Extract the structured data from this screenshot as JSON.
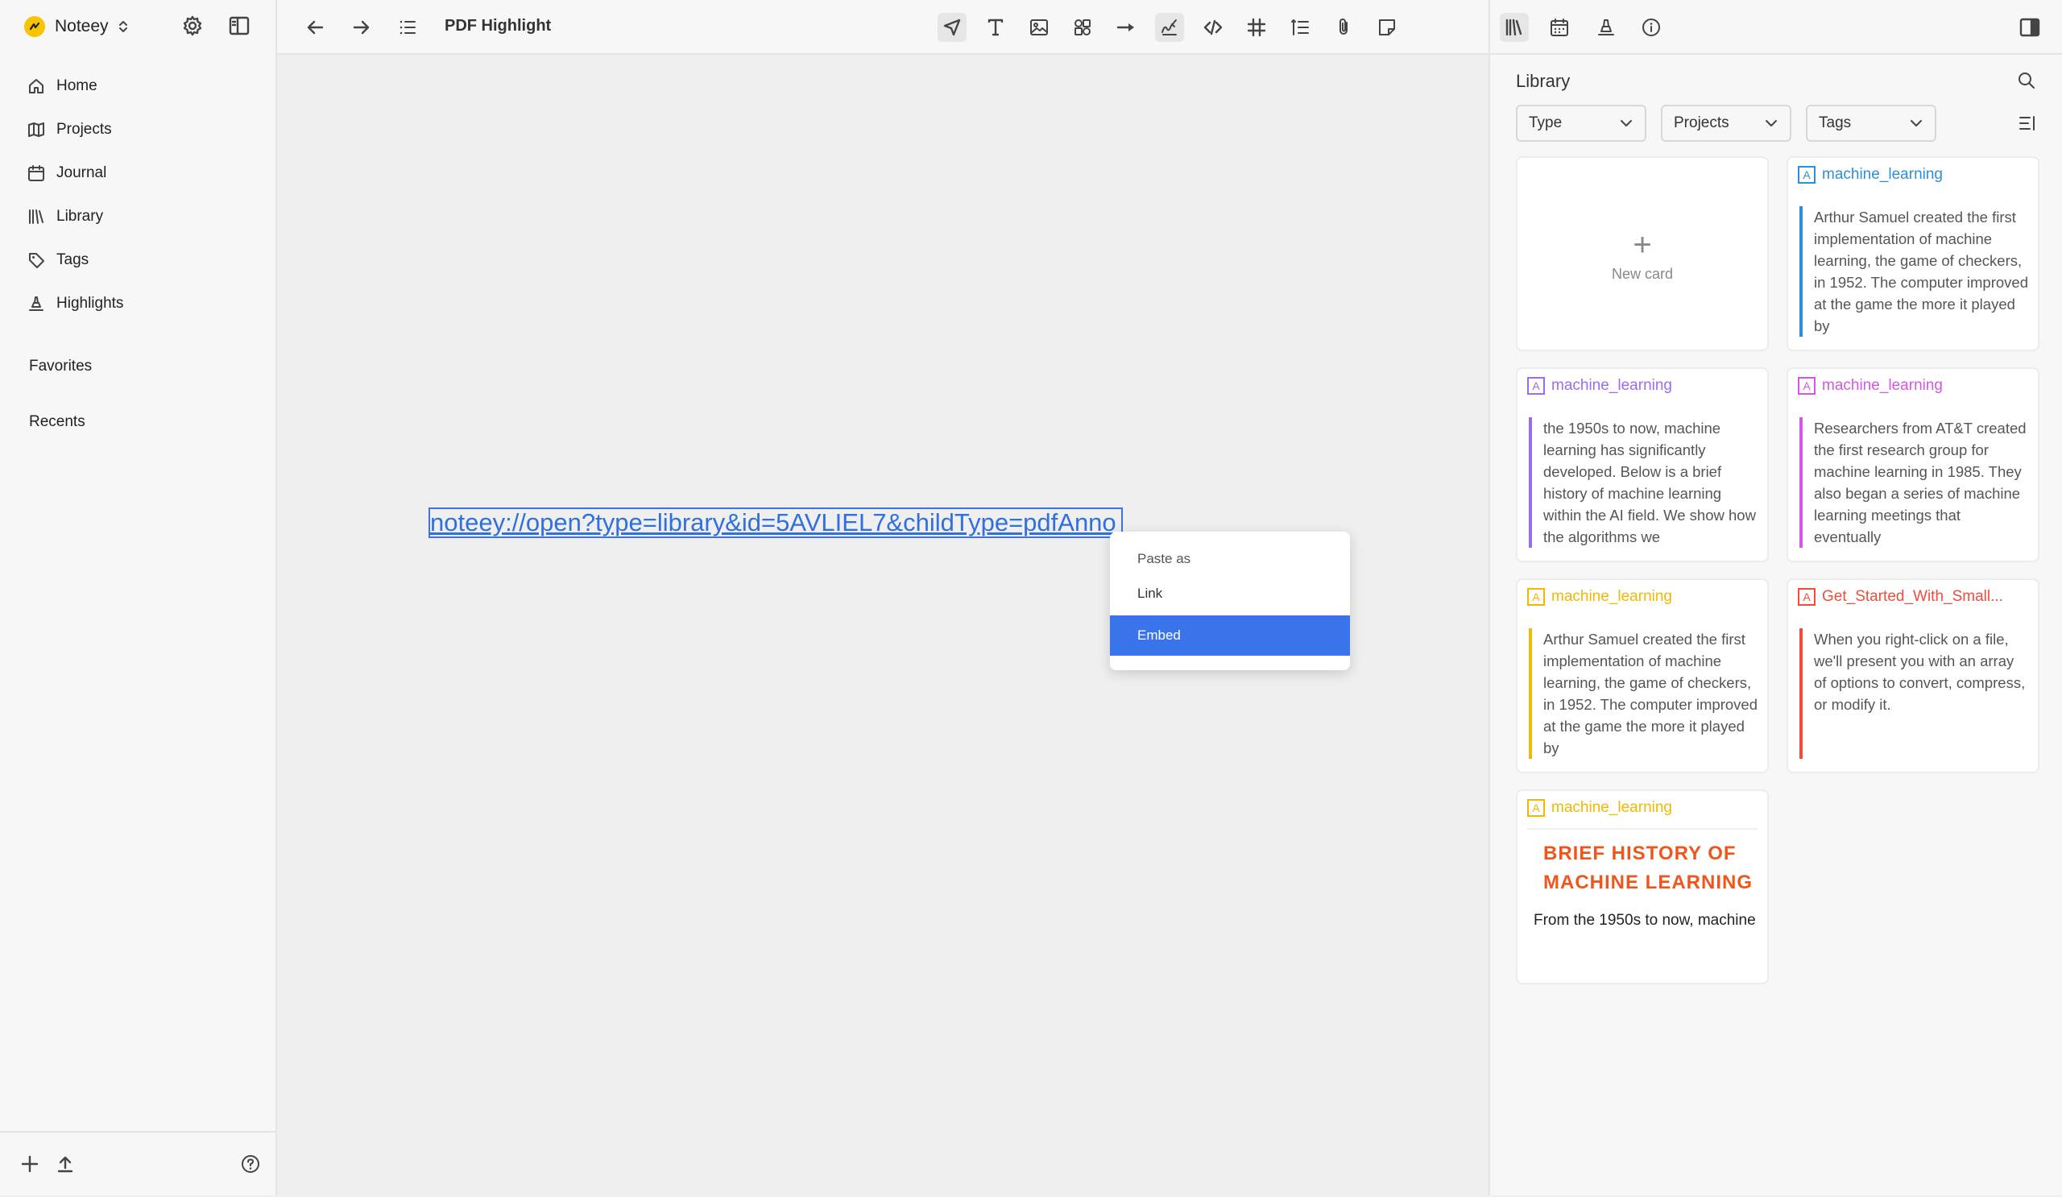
{
  "app": {
    "name": "Noteey"
  },
  "sidebar": {
    "nav": [
      {
        "label": "Home",
        "icon": "home-icon"
      },
      {
        "label": "Projects",
        "icon": "map-icon"
      },
      {
        "label": "Journal",
        "icon": "calendar-icon"
      },
      {
        "label": "Library",
        "icon": "library-icon"
      },
      {
        "label": "Tags",
        "icon": "tag-icon"
      },
      {
        "label": "Highlights",
        "icon": "highlighter-icon"
      }
    ],
    "sections": {
      "favorites": "Favorites",
      "recents": "Recents"
    }
  },
  "topbar": {
    "title": "PDF Highlight",
    "tools": [
      "select-icon",
      "text-icon",
      "image-icon",
      "shapes-icon",
      "arrow-icon",
      "pen-icon",
      "code-icon",
      "grid-icon",
      "list-icon",
      "attach-icon",
      "sticky-note-icon"
    ]
  },
  "canvas": {
    "pasted_link": "noteey://open?type=library&id=5AVLIEL7&childType=pdfAnno"
  },
  "context_menu": {
    "header": "Paste as",
    "items": [
      {
        "label": "Link",
        "selected": false
      },
      {
        "label": "Embed",
        "selected": true
      }
    ]
  },
  "library": {
    "title": "Library",
    "filters": [
      "Type",
      "Projects",
      "Tags"
    ],
    "new_card_label": "New card",
    "cards": [
      {
        "badge": "A",
        "tag": "machine_learning",
        "color": "#2d8fd5",
        "text": "Arthur Samuel created the first implementation of machine learning, the game of checkers, in 1952. The computer improved at the game the more it played by"
      },
      {
        "badge": "A",
        "tag": "machine_learning",
        "color": "#9b6cf0",
        "text": "the 1950s to now, machine learning has significantly developed. Below is a brief history of machine learning within the AI field. We show how the algorithms we"
      },
      {
        "badge": "A",
        "tag": "machine_learning",
        "color": "#d357e0",
        "text": "Researchers from AT&T created the first research group for machine learning in 1985. They also began a series of machine learning meetings that eventually"
      },
      {
        "badge": "A",
        "tag": "machine_learning",
        "color": "#f2b800",
        "text": "Arthur Samuel created the first implementation of machine learning, the game of checkers, in 1952. The computer improved at the game the more it played by"
      },
      {
        "badge": "A",
        "tag": "Get_Started_With_Small...",
        "color": "#ef4c3c",
        "text": "When you right-click on a file, we'll present you with an array of options to convert, compress, or modify it."
      },
      {
        "badge": "A",
        "tag": "machine_learning",
        "color": "#f2b800",
        "heading": "BRIEF HISTORY OF\nMACHINE LEARNING",
        "body": "From the 1950s to now, machine"
      }
    ]
  }
}
